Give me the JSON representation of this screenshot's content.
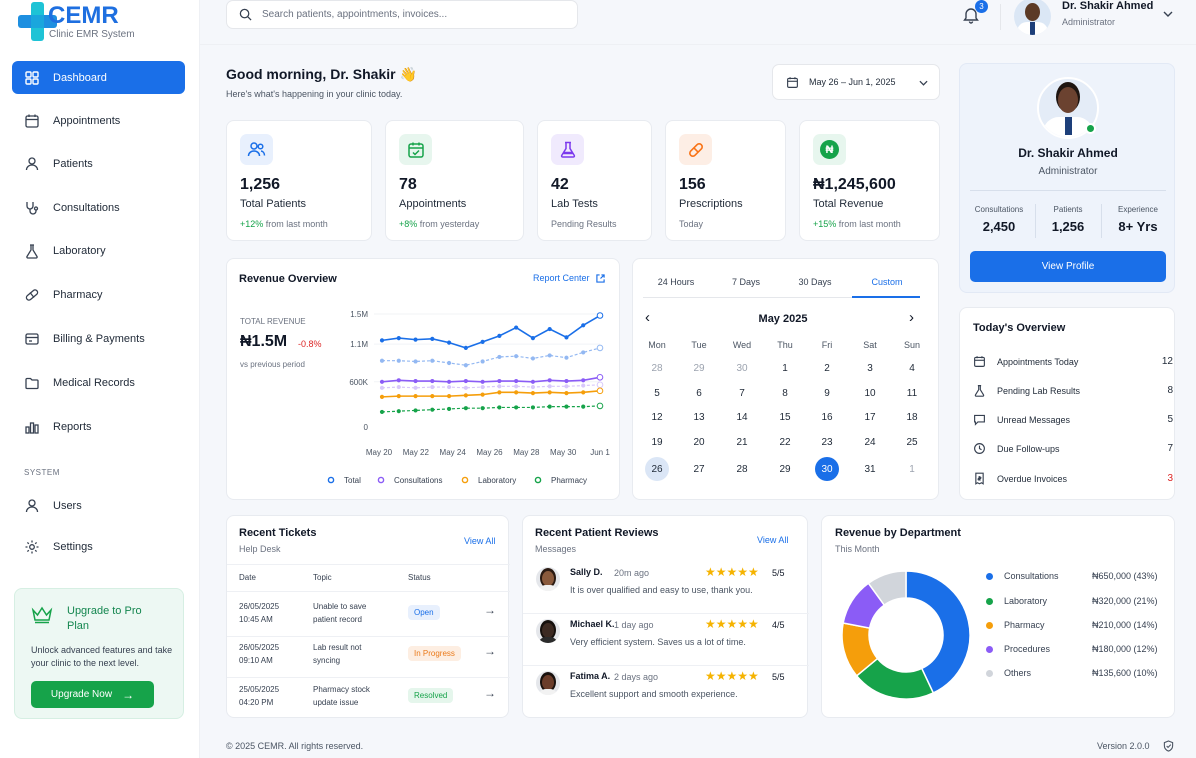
{
  "app": {
    "name": "CEMR",
    "subtitle": "Clinic EMR System"
  },
  "sidebar": {
    "items": [
      {
        "label": "Dashboard",
        "icon": "dashboard-icon"
      },
      {
        "label": "Appointments",
        "icon": "calendar-icon"
      },
      {
        "label": "Patients",
        "icon": "users-icon"
      },
      {
        "label": "Consultations",
        "icon": "stethoscope-icon"
      },
      {
        "label": "Laboratory",
        "icon": "flask-icon"
      },
      {
        "label": "Pharmacy",
        "icon": "pill-icon"
      },
      {
        "label": "Billing & Payments",
        "icon": "billing-icon"
      },
      {
        "label": "Medical Records",
        "icon": "folder-icon"
      },
      {
        "label": "Reports",
        "icon": "bar-chart-icon"
      }
    ],
    "system_label": "SYSTEM",
    "system_items": [
      {
        "label": "Users",
        "icon": "user-icon"
      },
      {
        "label": "Settings",
        "icon": "gear-icon"
      }
    ],
    "upgrade": {
      "title": "Upgrade to Pro Plan",
      "description": "Unlock advanced features and take your clinic to the next level.",
      "button": "Upgrade Now"
    }
  },
  "header": {
    "search_placeholder": "Search patients, appointments, invoices...",
    "notification_count": "3",
    "user_name": "Dr. Shakir Ahmed",
    "user_role": "Administrator"
  },
  "greeting": {
    "title": "Good morning, Dr. Shakir 👋",
    "subtitle": "Here's what's happening in your clinic today.",
    "date_range": "May 26 – Jun 1, 2025"
  },
  "stats": [
    {
      "value": "1,256",
      "label": "Total Patients",
      "change": "+12%",
      "sub": "from last month",
      "color": "#1a6fe8",
      "bg": "#e8f0fd"
    },
    {
      "value": "78",
      "label": "Appointments",
      "change": "+8%",
      "sub": "from yesterday",
      "color": "#16a34a",
      "bg": "#e7f6ee"
    },
    {
      "value": "42",
      "label": "Lab Tests",
      "change": "",
      "sub": "Pending Results",
      "color": "#7c3aed",
      "bg": "#f0eafd"
    },
    {
      "value": "156",
      "label": "Prescriptions",
      "change": "",
      "sub": "Today",
      "color": "#f97316",
      "bg": "#fdeee5"
    },
    {
      "value": "₦1,245,600",
      "label": "Total Revenue",
      "change": "+15%",
      "sub": "from last month",
      "color": "#16a34a",
      "bg": "#e7f6ee"
    }
  ],
  "profile": {
    "name": "Dr. Shakir Ahmed",
    "role": "Administrator",
    "metrics": [
      {
        "label": "Consultations",
        "value": "2,450"
      },
      {
        "label": "Patients",
        "value": "1,256"
      },
      {
        "label": "Experience",
        "value": "8+ Yrs"
      }
    ],
    "button": "View Profile"
  },
  "revenue": {
    "title": "Revenue Overview",
    "link": "Report Center",
    "total_label": "TOTAL REVENUE",
    "total_value": "₦1.5M",
    "change": "-0.8%",
    "compare": "vs previous period"
  },
  "chart_data": {
    "type": "line",
    "x": [
      "May 20",
      "May 22",
      "May 24",
      "May 26",
      "May 28",
      "May 30",
      "Jun 1"
    ],
    "ytick_labels": [
      "0",
      "600K",
      "1.1M",
      "1.5M"
    ],
    "ylim": [
      0,
      1500000
    ],
    "series": [
      {
        "name": "Total",
        "color": "#1a6fe8",
        "values": [
          1150000,
          1180000,
          1160000,
          1170000,
          1120000,
          1050000,
          1130000,
          1210000,
          1320000,
          1180000,
          1300000,
          1190000,
          1350000,
          1480000
        ]
      },
      {
        "name": "",
        "color": "#93b8f2",
        "dashed": true,
        "values": [
          880000,
          880000,
          870000,
          880000,
          850000,
          820000,
          870000,
          930000,
          940000,
          910000,
          950000,
          920000,
          990000,
          1050000
        ]
      },
      {
        "name": "Consultations",
        "color": "#8b5cf6",
        "values": [
          600000,
          620000,
          610000,
          610000,
          600000,
          610000,
          600000,
          610000,
          610000,
          600000,
          620000,
          610000,
          620000,
          660000
        ]
      },
      {
        "name": "",
        "color": "#d8c8fb",
        "dashed": true,
        "values": [
          520000,
          530000,
          520000,
          530000,
          530000,
          520000,
          530000,
          540000,
          540000,
          530000,
          540000,
          540000,
          550000,
          560000
        ]
      },
      {
        "name": "Laboratory",
        "color": "#f59e0b",
        "values": [
          400000,
          410000,
          410000,
          410000,
          410000,
          420000,
          430000,
          460000,
          460000,
          450000,
          460000,
          450000,
          460000,
          480000
        ]
      },
      {
        "name": "Pharmacy",
        "color": "#16a34a",
        "dashed": true,
        "values": [
          200000,
          210000,
          220000,
          230000,
          240000,
          250000,
          250000,
          260000,
          260000,
          260000,
          270000,
          270000,
          270000,
          280000
        ]
      }
    ]
  },
  "calendar": {
    "tabs": [
      "24 Hours",
      "7 Days",
      "30 Days",
      "Custom"
    ],
    "month": "May 2025",
    "weekdays": [
      "Mon",
      "Tue",
      "Wed",
      "Thu",
      "Fri",
      "Sat",
      "Sun"
    ],
    "days": [
      [
        "28",
        "29",
        "30",
        "1",
        "2",
        "3",
        "4"
      ],
      [
        "5",
        "6",
        "7",
        "8",
        "9",
        "10",
        "11"
      ],
      [
        "12",
        "13",
        "14",
        "15",
        "16",
        "17",
        "18"
      ],
      [
        "19",
        "20",
        "21",
        "22",
        "23",
        "24",
        "25"
      ],
      [
        "26",
        "27",
        "28",
        "29",
        "30",
        "31",
        "1"
      ]
    ]
  },
  "overview": {
    "title": "Today's Overview",
    "items": [
      {
        "label": "Appointments Today",
        "value": "12",
        "icon": "calendar-icon"
      },
      {
        "label": "Pending Lab Results",
        "value": "8",
        "icon": "flask-icon"
      },
      {
        "label": "Unread Messages",
        "value": "5",
        "icon": "message-icon"
      },
      {
        "label": "Due Follow-ups",
        "value": "7",
        "icon": "clock-icon"
      },
      {
        "label": "Overdue Invoices",
        "value": "3",
        "icon": "invoice-icon"
      }
    ]
  },
  "tickets": {
    "title": "Recent Tickets",
    "subtitle": "Help Desk",
    "link": "View All",
    "columns": [
      "Date",
      "Topic",
      "Status"
    ],
    "rows": [
      {
        "date": "26/05/2025",
        "time": "10:45 AM",
        "topic1": "Unable to save",
        "topic2": "patient record",
        "status": "Open",
        "fg": "#1a6fe8",
        "bg": "#e8f0fd"
      },
      {
        "date": "26/05/2025",
        "time": "09:10 AM",
        "topic1": "Lab result not",
        "topic2": "syncing",
        "status": "In Progress",
        "fg": "#ea7a1a",
        "bg": "#fdeee2"
      },
      {
        "date": "25/05/2025",
        "time": "04:20 PM",
        "topic1": "Pharmacy stock",
        "topic2": "update issue",
        "status": "Resolved",
        "fg": "#16a34a",
        "bg": "#e5f6ec"
      }
    ]
  },
  "reviews": {
    "title": "Recent Patient Reviews",
    "subtitle": "Messages",
    "link": "View All",
    "items": [
      {
        "name": "Sally D.",
        "time": "20m ago",
        "score": "5/5",
        "stars": "★★★★★",
        "text": "It is over qualified and easy to use, thank you."
      },
      {
        "name": "Michael K.",
        "time": "1 day ago",
        "score": "4/5",
        "stars": "★★★★★",
        "text": "Very efficient system. Saves us a lot of time."
      },
      {
        "name": "Fatima A.",
        "time": "2 days ago",
        "score": "5/5",
        "stars": "★★★★★",
        "text": "Excellent support and smooth experience."
      }
    ]
  },
  "department": {
    "title": "Revenue by Department",
    "subtitle": "This Month",
    "slices": [
      {
        "name": "Consultations",
        "value": "₦650,000 (43%)",
        "pct": 43,
        "color": "#1a6fe8"
      },
      {
        "name": "Laboratory",
        "value": "₦320,000 (21%)",
        "pct": 21,
        "color": "#16a34a"
      },
      {
        "name": "Pharmacy",
        "value": "₦210,000 (14%)",
        "pct": 14,
        "color": "#f59e0b"
      },
      {
        "name": "Procedures",
        "value": "₦180,000 (12%)",
        "pct": 12,
        "color": "#8b5cf6"
      },
      {
        "name": "Others",
        "value": "₦135,600 (10%)",
        "pct": 10,
        "color": "#d1d5db"
      }
    ]
  },
  "footer": {
    "copyright": "© 2025 CEMR. All rights reserved.",
    "version": "Version 2.0.0"
  }
}
